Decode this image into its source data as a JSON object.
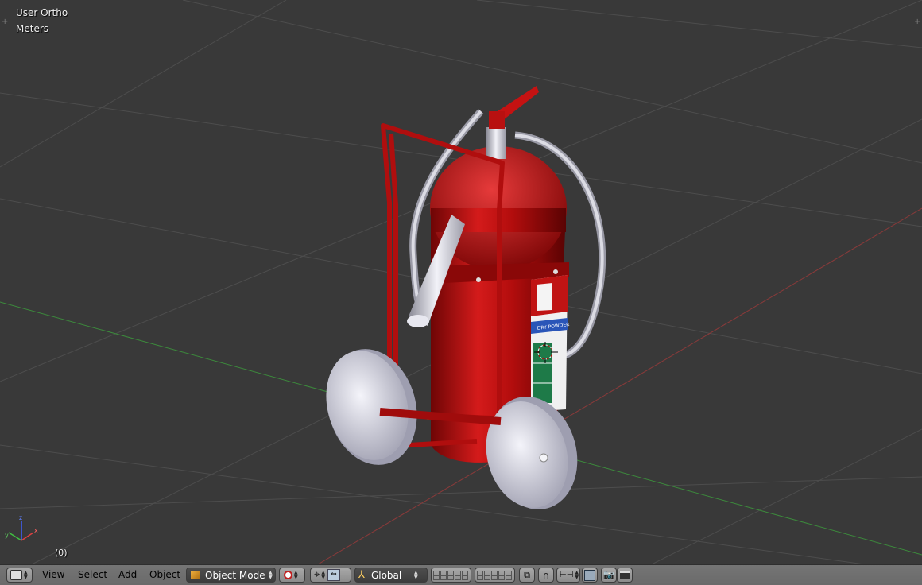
{
  "viewport": {
    "view_name": "User Ortho",
    "units": "Meters",
    "frame": "(0)"
  },
  "header": {
    "menus": [
      "View",
      "Select",
      "Add",
      "Object"
    ],
    "mode": "Object Mode",
    "orientation": "Global"
  },
  "model": {
    "label_text": "DRY POWDER"
  },
  "colors": {
    "viewport_bg": "#393939",
    "grid_line": "#4d4d4d",
    "x_axis": "#8a3a3a",
    "y_axis": "#3c8a3c",
    "extinguisher_red": "#b80f0f",
    "wheel_silver": "#c8c8d8",
    "header_bg": "#727272"
  },
  "icons": [
    "editor-type-icon",
    "object-mode-cube-icon",
    "viewport-shading-icon",
    "pivot-point-icon",
    "manipulator-icon",
    "transform-orientation-icon",
    "layers-icon",
    "render-icon"
  ]
}
